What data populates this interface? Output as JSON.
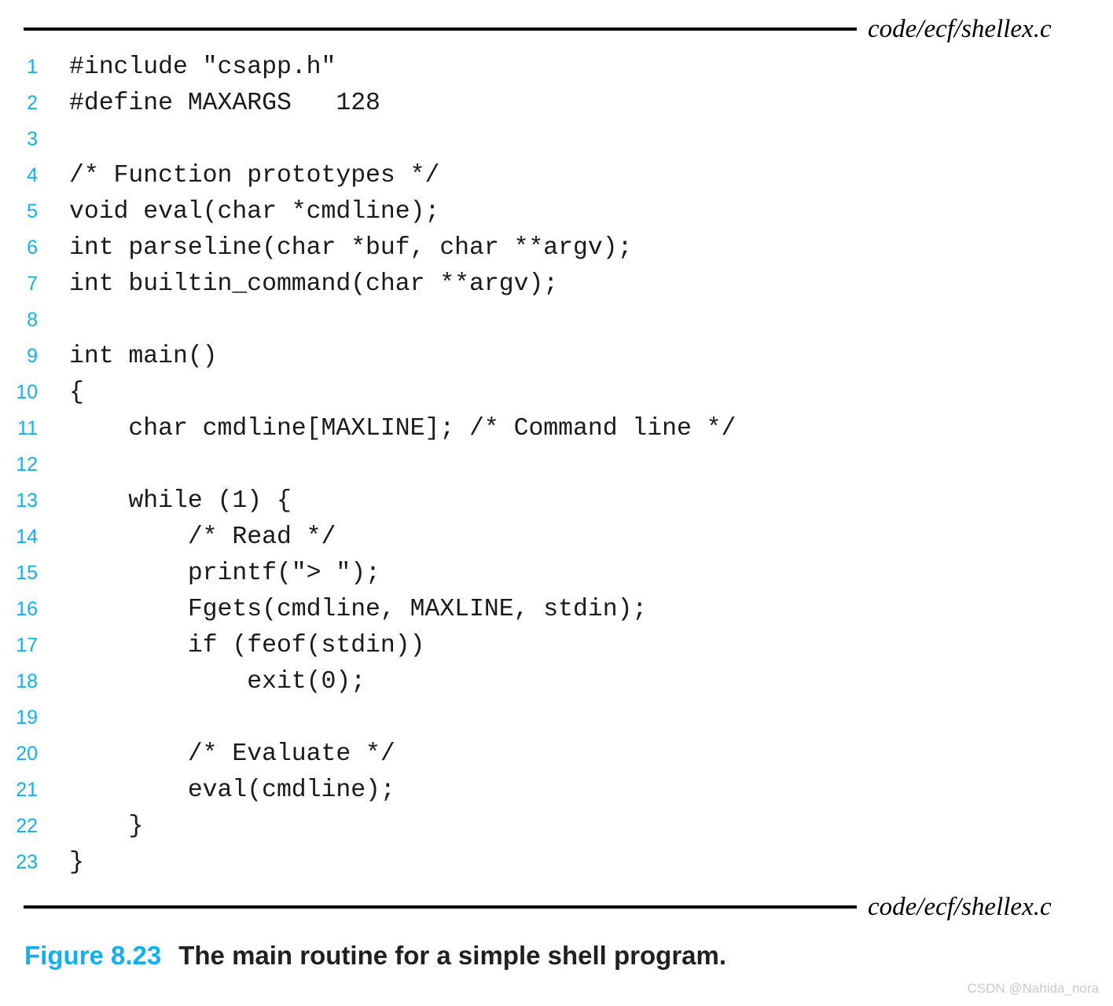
{
  "figure": {
    "header_path": "code/ecf/shellex.c",
    "footer_path": "code/ecf/shellex.c",
    "caption_label": "Figure 8.23",
    "caption_text": "The main routine for a simple shell program.",
    "watermark": "CSDN @Nahida_nora",
    "accent_color": "#12B0EF",
    "rule_color": "#000000",
    "code_color": "#1a1a1a"
  },
  "code": {
    "language": "c",
    "first_line_number": 1,
    "last_line_number": 23,
    "lines": [
      {
        "n": "1",
        "text": "#include \"csapp.h\""
      },
      {
        "n": "2",
        "text": "#define MAXARGS   128"
      },
      {
        "n": "3",
        "text": ""
      },
      {
        "n": "4",
        "text": "/* Function prototypes */"
      },
      {
        "n": "5",
        "text": "void eval(char *cmdline);"
      },
      {
        "n": "6",
        "text": "int parseline(char *buf, char **argv);"
      },
      {
        "n": "7",
        "text": "int builtin_command(char **argv);"
      },
      {
        "n": "8",
        "text": ""
      },
      {
        "n": "9",
        "text": "int main()"
      },
      {
        "n": "10",
        "text": "{"
      },
      {
        "n": "11",
        "text": "    char cmdline[MAXLINE]; /* Command line */"
      },
      {
        "n": "12",
        "text": ""
      },
      {
        "n": "13",
        "text": "    while (1) {"
      },
      {
        "n": "14",
        "text": "        /* Read */"
      },
      {
        "n": "15",
        "text": "        printf(\"> \");"
      },
      {
        "n": "16",
        "text": "        Fgets(cmdline, MAXLINE, stdin);"
      },
      {
        "n": "17",
        "text": "        if (feof(stdin))"
      },
      {
        "n": "18",
        "text": "            exit(0);"
      },
      {
        "n": "19",
        "text": ""
      },
      {
        "n": "20",
        "text": "        /* Evaluate */"
      },
      {
        "n": "21",
        "text": "        eval(cmdline);"
      },
      {
        "n": "22",
        "text": "    }"
      },
      {
        "n": "23",
        "text": "}"
      }
    ]
  }
}
